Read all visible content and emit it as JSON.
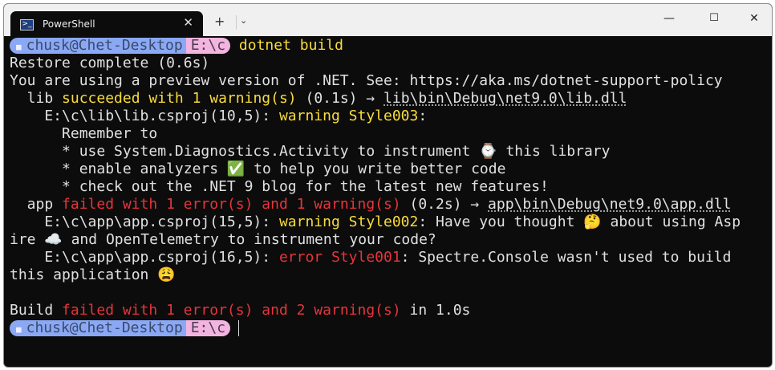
{
  "window": {
    "tab_title": "PowerShell",
    "tab_icon": "powershell-icon",
    "controls": [
      "minimize-icon",
      "maximize-icon",
      "close-icon"
    ]
  },
  "prompt": {
    "user": "chusk@Chet-Desktop",
    "dir": "E:\\c",
    "command": "dotnet build"
  },
  "colors": {
    "text": "#e0e0e0",
    "warning": "#f8dc3c",
    "error": "#e8343c",
    "prompt_user_bg": "#8aa8f4",
    "prompt_dir_bg": "#f4b4e0"
  },
  "lines": [
    [
      {
        "t": "Restore complete (0.6s)",
        "c": "w"
      }
    ],
    [
      {
        "t": "You are using a preview version of .NET. See: https://aka.ms/dotnet-support-policy",
        "c": "w"
      }
    ],
    [
      {
        "t": "  lib ",
        "c": "w"
      },
      {
        "t": "succeeded with 1 warning(s)",
        "c": "y"
      },
      {
        "t": " (0.1s) → ",
        "c": "w"
      },
      {
        "t": "lib\\bin\\Debug\\net9.0\\lib.dll",
        "c": "w u"
      }
    ],
    [
      {
        "t": "    E:\\c\\lib\\lib.csproj(10,5): ",
        "c": "w"
      },
      {
        "t": "warning Style003",
        "c": "y"
      },
      {
        "t": ":",
        "c": "w"
      }
    ],
    [
      {
        "t": "      Remember to",
        "c": "w"
      }
    ],
    [
      {
        "t": "      * use System.Diagnostics.Activity to instrument ⌚ this library",
        "c": "w"
      }
    ],
    [
      {
        "t": "      * enable analyzers ✅ to help you write better code",
        "c": "w"
      }
    ],
    [
      {
        "t": "      * check out the .NET 9 blog for the latest new features!",
        "c": "w"
      }
    ],
    [
      {
        "t": "  app ",
        "c": "w"
      },
      {
        "t": "failed with 1 error(s) and 1 warning(s)",
        "c": "r"
      },
      {
        "t": " (0.2s) → ",
        "c": "w"
      },
      {
        "t": "app\\bin\\Debug\\net9.0\\app.dll",
        "c": "w u"
      }
    ],
    [
      {
        "t": "    E:\\c\\app\\app.csproj(15,5): ",
        "c": "w"
      },
      {
        "t": "warning Style002",
        "c": "y"
      },
      {
        "t": ": Have you thought 🤔 about using Asp",
        "c": "w"
      }
    ],
    [
      {
        "t": "ire ☁️ and OpenTelemetry to instrument your code?",
        "c": "w"
      }
    ],
    [
      {
        "t": "    E:\\c\\app\\app.csproj(16,5): ",
        "c": "w"
      },
      {
        "t": "error Style001",
        "c": "r"
      },
      {
        "t": ": Spectre.Console wasn't used to build",
        "c": "w"
      }
    ],
    [
      {
        "t": "this application 😩",
        "c": "w"
      }
    ],
    [
      {
        "t": "",
        "c": "w"
      }
    ],
    [
      {
        "t": "Build ",
        "c": "w"
      },
      {
        "t": "failed with 1 error(s) and 2 warning(s)",
        "c": "r"
      },
      {
        "t": " in 1.0s",
        "c": "w"
      }
    ]
  ]
}
